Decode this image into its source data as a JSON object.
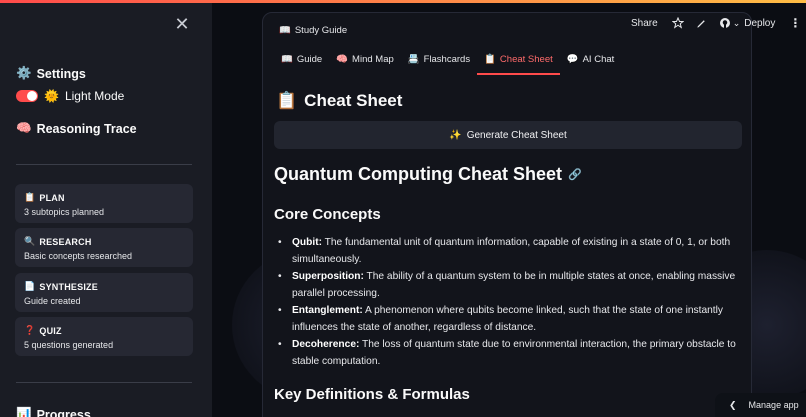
{
  "sidebar": {
    "settings_icon": "⚙️",
    "settings_label": "Settings",
    "light_mode_icon": "🌞",
    "light_mode_label": "Light Mode",
    "light_mode_on": true,
    "reasoning_icon": "🧠",
    "reasoning_label": "Reasoning Trace",
    "steps": [
      {
        "icon": "📋",
        "title": "PLAN",
        "subtitle": "3 subtopics planned"
      },
      {
        "icon": "🔍",
        "title": "RESEARCH",
        "subtitle": "Basic concepts researched"
      },
      {
        "icon": "📄",
        "title": "SYNTHESIZE",
        "subtitle": "Guide created"
      },
      {
        "icon": "❓",
        "title": "QUIZ",
        "subtitle": "5 questions generated"
      }
    ],
    "progress_icon": "📊",
    "progress_label": "Progress"
  },
  "toolbar": {
    "share_label": "Share",
    "deploy_label": "Deploy"
  },
  "card": {
    "title_icon": "📖",
    "title": "Study Guide",
    "tabs": [
      {
        "icon": "📖",
        "label": "Guide"
      },
      {
        "icon": "🧠",
        "label": "Mind Map"
      },
      {
        "icon": "📇",
        "label": "Flashcards"
      },
      {
        "icon": "📋",
        "label": "Cheat Sheet",
        "active": true
      },
      {
        "icon": "💬",
        "label": "AI Chat"
      }
    ],
    "heading_icon": "📋",
    "heading": "Cheat Sheet",
    "generate_icon": "✨",
    "generate_label": "Generate Cheat Sheet",
    "sheet_title": "Quantum Computing Cheat Sheet",
    "core_heading": "Core Concepts",
    "concepts": [
      {
        "term": "Qubit:",
        "text": " The fundamental unit of quantum information, capable of existing in a state of 0, 1, or both simultaneously."
      },
      {
        "term": "Superposition:",
        "text": " The ability of a quantum system to be in multiple states at once, enabling massive parallel processing."
      },
      {
        "term": "Entanglement:",
        "text": " A phenomenon where qubits become linked, such that the state of one instantly influences the state of another, regardless of distance."
      },
      {
        "term": "Decoherence:",
        "text": " The loss of quantum state due to environmental interaction, the primary obstacle to stable computation."
      }
    ],
    "defs_heading": "Key Definitions & Formulas"
  },
  "manage_app_label": "Manage app",
  "colors": {
    "accent": "#ff4b4b",
    "sidebar_bg": "#1a1c24",
    "main_bg": "#0e1117"
  }
}
